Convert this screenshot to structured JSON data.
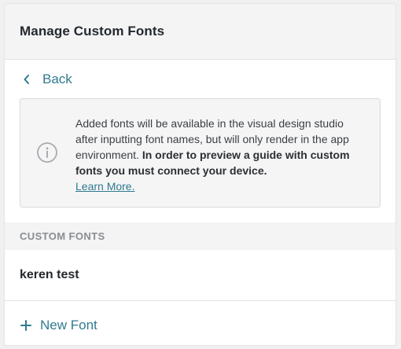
{
  "header": {
    "title": "Manage Custom Fonts"
  },
  "back": {
    "label": "Back",
    "icon": "chevron-left-icon"
  },
  "info": {
    "icon": "info-circle-icon",
    "text_plain": "Added fonts will be available in the visual design studio after inputting font names, but will only render in the app environment.",
    "text_bold": "In order to preview a guide with custom fonts you must connect your device.",
    "link": "Learn More."
  },
  "custom_fonts": {
    "section_title": "CUSTOM FONTS",
    "items": [
      {
        "name": "keren test"
      }
    ]
  },
  "new_font": {
    "label": "New Font",
    "icon": "plus-icon"
  },
  "colors": {
    "accent": "#2f7a8f",
    "header_bg": "#f4f4f5",
    "text": "#24292e",
    "muted": "#8a8d91"
  }
}
